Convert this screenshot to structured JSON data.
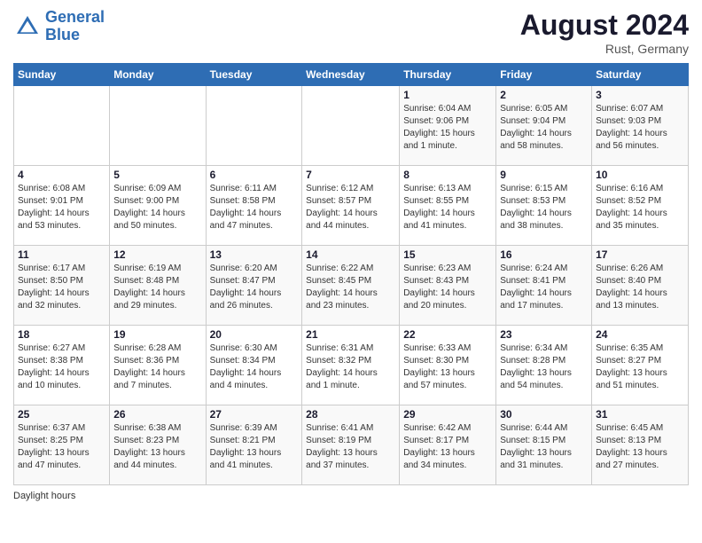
{
  "logo": {
    "line1": "General",
    "line2": "Blue"
  },
  "title": "August 2024",
  "subtitle": "Rust, Germany",
  "days_of_week": [
    "Sunday",
    "Monday",
    "Tuesday",
    "Wednesday",
    "Thursday",
    "Friday",
    "Saturday"
  ],
  "footer": "Daylight hours",
  "weeks": [
    [
      {
        "num": "",
        "info": ""
      },
      {
        "num": "",
        "info": ""
      },
      {
        "num": "",
        "info": ""
      },
      {
        "num": "",
        "info": ""
      },
      {
        "num": "1",
        "info": "Sunrise: 6:04 AM\nSunset: 9:06 PM\nDaylight: 15 hours\nand 1 minute."
      },
      {
        "num": "2",
        "info": "Sunrise: 6:05 AM\nSunset: 9:04 PM\nDaylight: 14 hours\nand 58 minutes."
      },
      {
        "num": "3",
        "info": "Sunrise: 6:07 AM\nSunset: 9:03 PM\nDaylight: 14 hours\nand 56 minutes."
      }
    ],
    [
      {
        "num": "4",
        "info": "Sunrise: 6:08 AM\nSunset: 9:01 PM\nDaylight: 14 hours\nand 53 minutes."
      },
      {
        "num": "5",
        "info": "Sunrise: 6:09 AM\nSunset: 9:00 PM\nDaylight: 14 hours\nand 50 minutes."
      },
      {
        "num": "6",
        "info": "Sunrise: 6:11 AM\nSunset: 8:58 PM\nDaylight: 14 hours\nand 47 minutes."
      },
      {
        "num": "7",
        "info": "Sunrise: 6:12 AM\nSunset: 8:57 PM\nDaylight: 14 hours\nand 44 minutes."
      },
      {
        "num": "8",
        "info": "Sunrise: 6:13 AM\nSunset: 8:55 PM\nDaylight: 14 hours\nand 41 minutes."
      },
      {
        "num": "9",
        "info": "Sunrise: 6:15 AM\nSunset: 8:53 PM\nDaylight: 14 hours\nand 38 minutes."
      },
      {
        "num": "10",
        "info": "Sunrise: 6:16 AM\nSunset: 8:52 PM\nDaylight: 14 hours\nand 35 minutes."
      }
    ],
    [
      {
        "num": "11",
        "info": "Sunrise: 6:17 AM\nSunset: 8:50 PM\nDaylight: 14 hours\nand 32 minutes."
      },
      {
        "num": "12",
        "info": "Sunrise: 6:19 AM\nSunset: 8:48 PM\nDaylight: 14 hours\nand 29 minutes."
      },
      {
        "num": "13",
        "info": "Sunrise: 6:20 AM\nSunset: 8:47 PM\nDaylight: 14 hours\nand 26 minutes."
      },
      {
        "num": "14",
        "info": "Sunrise: 6:22 AM\nSunset: 8:45 PM\nDaylight: 14 hours\nand 23 minutes."
      },
      {
        "num": "15",
        "info": "Sunrise: 6:23 AM\nSunset: 8:43 PM\nDaylight: 14 hours\nand 20 minutes."
      },
      {
        "num": "16",
        "info": "Sunrise: 6:24 AM\nSunset: 8:41 PM\nDaylight: 14 hours\nand 17 minutes."
      },
      {
        "num": "17",
        "info": "Sunrise: 6:26 AM\nSunset: 8:40 PM\nDaylight: 14 hours\nand 13 minutes."
      }
    ],
    [
      {
        "num": "18",
        "info": "Sunrise: 6:27 AM\nSunset: 8:38 PM\nDaylight: 14 hours\nand 10 minutes."
      },
      {
        "num": "19",
        "info": "Sunrise: 6:28 AM\nSunset: 8:36 PM\nDaylight: 14 hours\nand 7 minutes."
      },
      {
        "num": "20",
        "info": "Sunrise: 6:30 AM\nSunset: 8:34 PM\nDaylight: 14 hours\nand 4 minutes."
      },
      {
        "num": "21",
        "info": "Sunrise: 6:31 AM\nSunset: 8:32 PM\nDaylight: 14 hours\nand 1 minute."
      },
      {
        "num": "22",
        "info": "Sunrise: 6:33 AM\nSunset: 8:30 PM\nDaylight: 13 hours\nand 57 minutes."
      },
      {
        "num": "23",
        "info": "Sunrise: 6:34 AM\nSunset: 8:28 PM\nDaylight: 13 hours\nand 54 minutes."
      },
      {
        "num": "24",
        "info": "Sunrise: 6:35 AM\nSunset: 8:27 PM\nDaylight: 13 hours\nand 51 minutes."
      }
    ],
    [
      {
        "num": "25",
        "info": "Sunrise: 6:37 AM\nSunset: 8:25 PM\nDaylight: 13 hours\nand 47 minutes."
      },
      {
        "num": "26",
        "info": "Sunrise: 6:38 AM\nSunset: 8:23 PM\nDaylight: 13 hours\nand 44 minutes."
      },
      {
        "num": "27",
        "info": "Sunrise: 6:39 AM\nSunset: 8:21 PM\nDaylight: 13 hours\nand 41 minutes."
      },
      {
        "num": "28",
        "info": "Sunrise: 6:41 AM\nSunset: 8:19 PM\nDaylight: 13 hours\nand 37 minutes."
      },
      {
        "num": "29",
        "info": "Sunrise: 6:42 AM\nSunset: 8:17 PM\nDaylight: 13 hours\nand 34 minutes."
      },
      {
        "num": "30",
        "info": "Sunrise: 6:44 AM\nSunset: 8:15 PM\nDaylight: 13 hours\nand 31 minutes."
      },
      {
        "num": "31",
        "info": "Sunrise: 6:45 AM\nSunset: 8:13 PM\nDaylight: 13 hours\nand 27 minutes."
      }
    ]
  ]
}
